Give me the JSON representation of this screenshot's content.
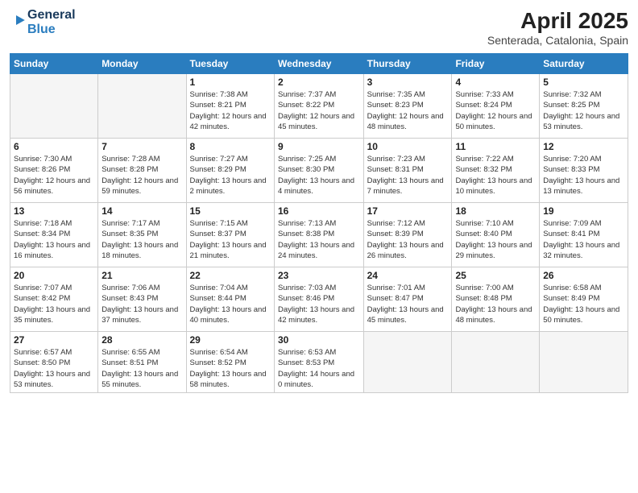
{
  "header": {
    "logo_line1": "General",
    "logo_line2": "Blue",
    "month_year": "April 2025",
    "location": "Senterada, Catalonia, Spain"
  },
  "days_of_week": [
    "Sunday",
    "Monday",
    "Tuesday",
    "Wednesday",
    "Thursday",
    "Friday",
    "Saturday"
  ],
  "weeks": [
    [
      {
        "day": "",
        "info": ""
      },
      {
        "day": "",
        "info": ""
      },
      {
        "day": "1",
        "info": "Sunrise: 7:38 AM\nSunset: 8:21 PM\nDaylight: 12 hours and 42 minutes."
      },
      {
        "day": "2",
        "info": "Sunrise: 7:37 AM\nSunset: 8:22 PM\nDaylight: 12 hours and 45 minutes."
      },
      {
        "day": "3",
        "info": "Sunrise: 7:35 AM\nSunset: 8:23 PM\nDaylight: 12 hours and 48 minutes."
      },
      {
        "day": "4",
        "info": "Sunrise: 7:33 AM\nSunset: 8:24 PM\nDaylight: 12 hours and 50 minutes."
      },
      {
        "day": "5",
        "info": "Sunrise: 7:32 AM\nSunset: 8:25 PM\nDaylight: 12 hours and 53 minutes."
      }
    ],
    [
      {
        "day": "6",
        "info": "Sunrise: 7:30 AM\nSunset: 8:26 PM\nDaylight: 12 hours and 56 minutes."
      },
      {
        "day": "7",
        "info": "Sunrise: 7:28 AM\nSunset: 8:28 PM\nDaylight: 12 hours and 59 minutes."
      },
      {
        "day": "8",
        "info": "Sunrise: 7:27 AM\nSunset: 8:29 PM\nDaylight: 13 hours and 2 minutes."
      },
      {
        "day": "9",
        "info": "Sunrise: 7:25 AM\nSunset: 8:30 PM\nDaylight: 13 hours and 4 minutes."
      },
      {
        "day": "10",
        "info": "Sunrise: 7:23 AM\nSunset: 8:31 PM\nDaylight: 13 hours and 7 minutes."
      },
      {
        "day": "11",
        "info": "Sunrise: 7:22 AM\nSunset: 8:32 PM\nDaylight: 13 hours and 10 minutes."
      },
      {
        "day": "12",
        "info": "Sunrise: 7:20 AM\nSunset: 8:33 PM\nDaylight: 13 hours and 13 minutes."
      }
    ],
    [
      {
        "day": "13",
        "info": "Sunrise: 7:18 AM\nSunset: 8:34 PM\nDaylight: 13 hours and 16 minutes."
      },
      {
        "day": "14",
        "info": "Sunrise: 7:17 AM\nSunset: 8:35 PM\nDaylight: 13 hours and 18 minutes."
      },
      {
        "day": "15",
        "info": "Sunrise: 7:15 AM\nSunset: 8:37 PM\nDaylight: 13 hours and 21 minutes."
      },
      {
        "day": "16",
        "info": "Sunrise: 7:13 AM\nSunset: 8:38 PM\nDaylight: 13 hours and 24 minutes."
      },
      {
        "day": "17",
        "info": "Sunrise: 7:12 AM\nSunset: 8:39 PM\nDaylight: 13 hours and 26 minutes."
      },
      {
        "day": "18",
        "info": "Sunrise: 7:10 AM\nSunset: 8:40 PM\nDaylight: 13 hours and 29 minutes."
      },
      {
        "day": "19",
        "info": "Sunrise: 7:09 AM\nSunset: 8:41 PM\nDaylight: 13 hours and 32 minutes."
      }
    ],
    [
      {
        "day": "20",
        "info": "Sunrise: 7:07 AM\nSunset: 8:42 PM\nDaylight: 13 hours and 35 minutes."
      },
      {
        "day": "21",
        "info": "Sunrise: 7:06 AM\nSunset: 8:43 PM\nDaylight: 13 hours and 37 minutes."
      },
      {
        "day": "22",
        "info": "Sunrise: 7:04 AM\nSunset: 8:44 PM\nDaylight: 13 hours and 40 minutes."
      },
      {
        "day": "23",
        "info": "Sunrise: 7:03 AM\nSunset: 8:46 PM\nDaylight: 13 hours and 42 minutes."
      },
      {
        "day": "24",
        "info": "Sunrise: 7:01 AM\nSunset: 8:47 PM\nDaylight: 13 hours and 45 minutes."
      },
      {
        "day": "25",
        "info": "Sunrise: 7:00 AM\nSunset: 8:48 PM\nDaylight: 13 hours and 48 minutes."
      },
      {
        "day": "26",
        "info": "Sunrise: 6:58 AM\nSunset: 8:49 PM\nDaylight: 13 hours and 50 minutes."
      }
    ],
    [
      {
        "day": "27",
        "info": "Sunrise: 6:57 AM\nSunset: 8:50 PM\nDaylight: 13 hours and 53 minutes."
      },
      {
        "day": "28",
        "info": "Sunrise: 6:55 AM\nSunset: 8:51 PM\nDaylight: 13 hours and 55 minutes."
      },
      {
        "day": "29",
        "info": "Sunrise: 6:54 AM\nSunset: 8:52 PM\nDaylight: 13 hours and 58 minutes."
      },
      {
        "day": "30",
        "info": "Sunrise: 6:53 AM\nSunset: 8:53 PM\nDaylight: 14 hours and 0 minutes."
      },
      {
        "day": "",
        "info": ""
      },
      {
        "day": "",
        "info": ""
      },
      {
        "day": "",
        "info": ""
      }
    ]
  ]
}
